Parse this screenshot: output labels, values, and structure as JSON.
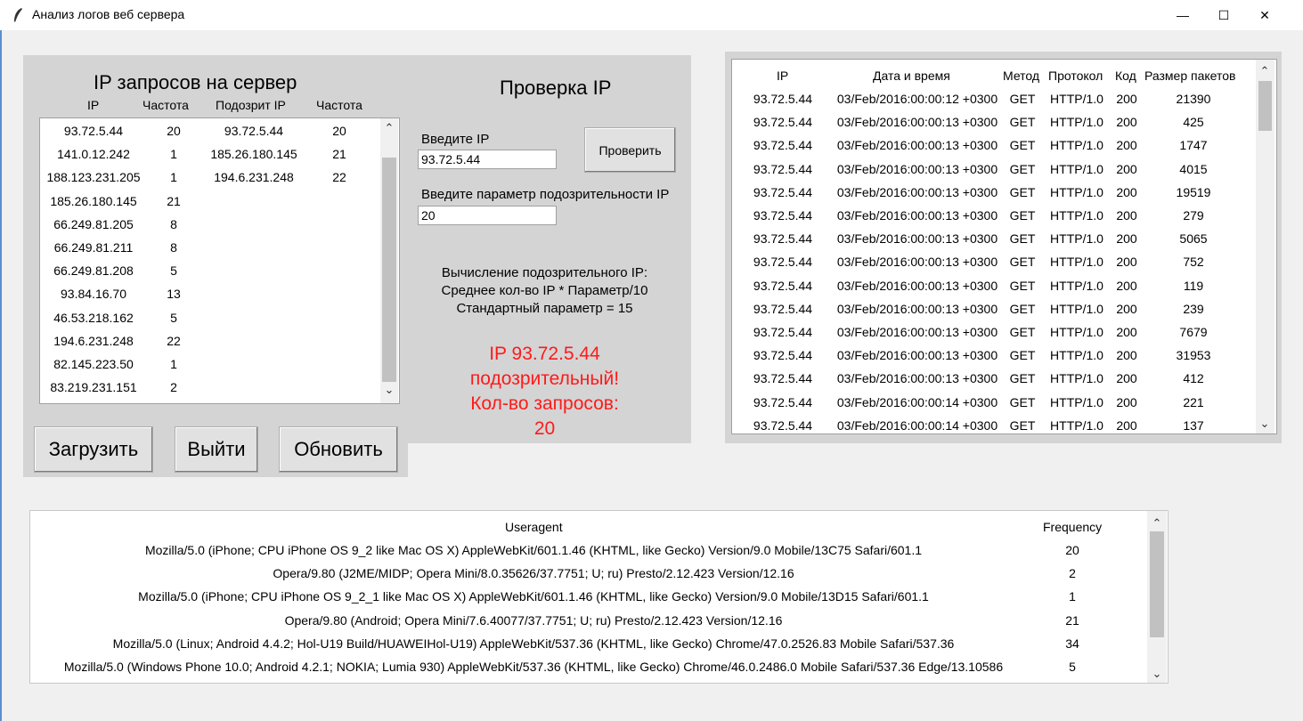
{
  "window": {
    "title": "Анализ логов веб сервера",
    "minimize_glyph": "—",
    "maximize_glyph": "☐",
    "close_glyph": "✕"
  },
  "ip_panel": {
    "title": "IP запросов на сервер",
    "headers": [
      "IP",
      "Частота",
      "Подозрит IP",
      "Частота"
    ],
    "rows": [
      [
        "93.72.5.44",
        "20",
        "93.72.5.44",
        "20"
      ],
      [
        "141.0.12.242",
        "1",
        "185.26.180.145",
        "21"
      ],
      [
        "188.123.231.205",
        "1",
        "194.6.231.248",
        "22"
      ],
      [
        "185.26.180.145",
        "21",
        "",
        ""
      ],
      [
        "66.249.81.205",
        "8",
        "",
        ""
      ],
      [
        "66.249.81.211",
        "8",
        "",
        ""
      ],
      [
        "66.249.81.208",
        "5",
        "",
        ""
      ],
      [
        "93.84.16.70",
        "13",
        "",
        ""
      ],
      [
        "46.53.218.162",
        "5",
        "",
        ""
      ],
      [
        "194.6.231.248",
        "22",
        "",
        ""
      ],
      [
        "82.145.223.50",
        "1",
        "",
        ""
      ],
      [
        "83.219.231.151",
        "2",
        "",
        ""
      ]
    ],
    "buttons": {
      "load": "Загрузить",
      "exit": "Выйти",
      "refresh": "Обновить"
    }
  },
  "check_panel": {
    "title": "Проверка IP",
    "ip_label": "Введите IP",
    "ip_value": "93.72.5.44",
    "check_button": "Проверить",
    "param_label": "Введите параметр подозрительности IP",
    "param_value": "20",
    "formula": [
      "Вычисление подозрительного IP:",
      "Среднее кол-во IP * Параметр/10",
      "Стандартный параметр = 15"
    ],
    "result": [
      "IP 93.72.5.44",
      "подозрительный!",
      "Кол-во запросов:",
      "20"
    ],
    "result_color": "#ff1a1a"
  },
  "log_table": {
    "headers": [
      "IP",
      "Дата и время",
      "Метод",
      "Протокол",
      "Код",
      "Размер пакетов"
    ],
    "rows": [
      [
        "93.72.5.44",
        "03/Feb/2016:00:00:12 +0300",
        "GET",
        "HTTP/1.0",
        "200",
        "21390"
      ],
      [
        "93.72.5.44",
        "03/Feb/2016:00:00:13 +0300",
        "GET",
        "HTTP/1.0",
        "200",
        "425"
      ],
      [
        "93.72.5.44",
        "03/Feb/2016:00:00:13 +0300",
        "GET",
        "HTTP/1.0",
        "200",
        "1747"
      ],
      [
        "93.72.5.44",
        "03/Feb/2016:00:00:13 +0300",
        "GET",
        "HTTP/1.0",
        "200",
        "4015"
      ],
      [
        "93.72.5.44",
        "03/Feb/2016:00:00:13 +0300",
        "GET",
        "HTTP/1.0",
        "200",
        "19519"
      ],
      [
        "93.72.5.44",
        "03/Feb/2016:00:00:13 +0300",
        "GET",
        "HTTP/1.0",
        "200",
        "279"
      ],
      [
        "93.72.5.44",
        "03/Feb/2016:00:00:13 +0300",
        "GET",
        "HTTP/1.0",
        "200",
        "5065"
      ],
      [
        "93.72.5.44",
        "03/Feb/2016:00:00:13 +0300",
        "GET",
        "HTTP/1.0",
        "200",
        "752"
      ],
      [
        "93.72.5.44",
        "03/Feb/2016:00:00:13 +0300",
        "GET",
        "HTTP/1.0",
        "200",
        "119"
      ],
      [
        "93.72.5.44",
        "03/Feb/2016:00:00:13 +0300",
        "GET",
        "HTTP/1.0",
        "200",
        "239"
      ],
      [
        "93.72.5.44",
        "03/Feb/2016:00:00:13 +0300",
        "GET",
        "HTTP/1.0",
        "200",
        "7679"
      ],
      [
        "93.72.5.44",
        "03/Feb/2016:00:00:13 +0300",
        "GET",
        "HTTP/1.0",
        "200",
        "31953"
      ],
      [
        "93.72.5.44",
        "03/Feb/2016:00:00:13 +0300",
        "GET",
        "HTTP/1.0",
        "200",
        "412"
      ],
      [
        "93.72.5.44",
        "03/Feb/2016:00:00:14 +0300",
        "GET",
        "HTTP/1.0",
        "200",
        "221"
      ],
      [
        "93.72.5.44",
        "03/Feb/2016:00:00:14 +0300",
        "GET",
        "HTTP/1.0",
        "200",
        "137"
      ]
    ]
  },
  "useragent_table": {
    "headers": [
      "Useragent",
      "Frequency"
    ],
    "rows": [
      [
        "Mozilla/5.0 (iPhone; CPU iPhone OS 9_2 like Mac OS X) AppleWebKit/601.1.46 (KHTML, like Gecko) Version/9.0 Mobile/13C75 Safari/601.1",
        "20"
      ],
      [
        "Opera/9.80 (J2ME/MIDP; Opera Mini/8.0.35626/37.7751; U; ru) Presto/2.12.423 Version/12.16",
        "2"
      ],
      [
        "Mozilla/5.0 (iPhone; CPU iPhone OS 9_2_1 like Mac OS X) AppleWebKit/601.1.46 (KHTML, like Gecko) Version/9.0 Mobile/13D15 Safari/601.1",
        "1"
      ],
      [
        "Opera/9.80 (Android; Opera Mini/7.6.40077/37.7751; U; ru) Presto/2.12.423 Version/12.16",
        "21"
      ],
      [
        "Mozilla/5.0 (Linux; Android 4.4.2; Hol-U19 Build/HUAWEIHol-U19) AppleWebKit/537.36 (KHTML, like Gecko) Chrome/47.0.2526.83 Mobile Safari/537.36",
        "34"
      ],
      [
        "Mozilla/5.0 (Windows Phone 10.0; Android 4.2.1; NOKIA; Lumia 930) AppleWebKit/537.36 (KHTML, like Gecko) Chrome/46.0.2486.0 Mobile Safari/537.36 Edge/13.10586",
        "5"
      ]
    ]
  },
  "scroll_glyphs": {
    "up": "⌃",
    "down": "⌄"
  }
}
